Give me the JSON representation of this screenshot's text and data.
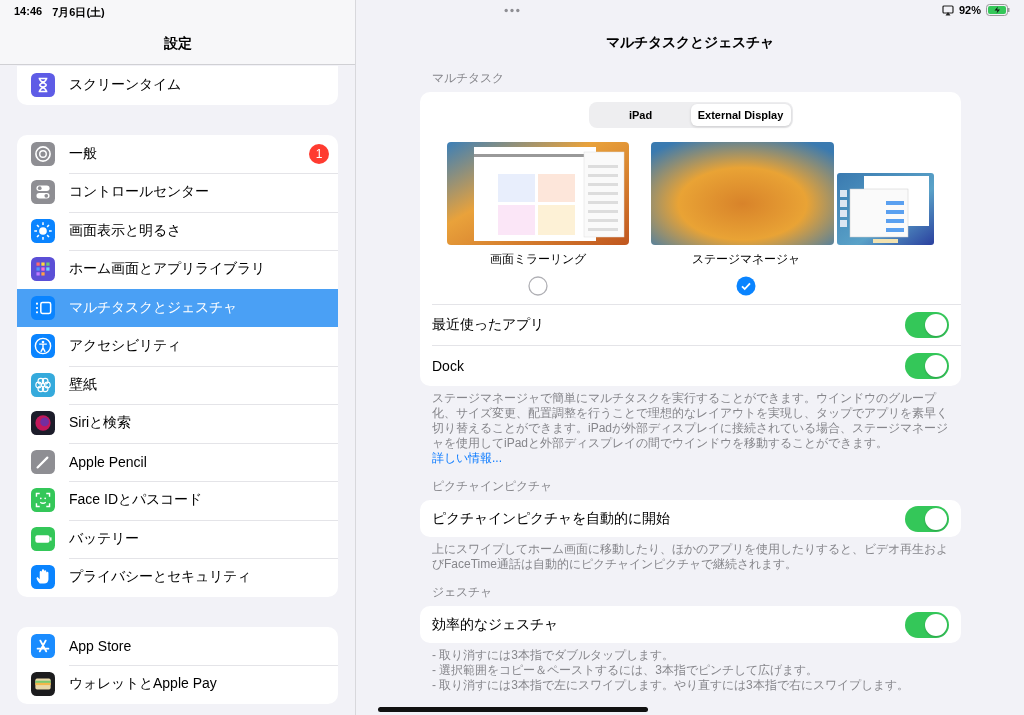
{
  "status_bar": {
    "time": "14:46",
    "date": "7月6日(土)",
    "battery": "92%"
  },
  "sidebar": {
    "title": "設定",
    "groups": [
      {
        "items": [
          {
            "label": "スクリーンタイム",
            "kind": "hourglass",
            "selected": false
          }
        ]
      },
      {
        "items": [
          {
            "label": "一般",
            "kind": "gear",
            "selected": false,
            "badge": "1"
          },
          {
            "label": "コントロールセンター",
            "kind": "switches",
            "selected": false
          },
          {
            "label": "画面表示と明るさ",
            "kind": "sun",
            "selected": false
          },
          {
            "label": "ホーム画面とアプリライブラリ",
            "kind": "grid",
            "selected": false
          },
          {
            "label": "マルチタスクとジェスチャ",
            "kind": "multitask",
            "selected": true
          },
          {
            "label": "アクセシビリティ",
            "kind": "accessibility",
            "selected": false
          },
          {
            "label": "壁紙",
            "kind": "flower",
            "selected": false
          },
          {
            "label": "Siriと検索",
            "kind": "orb",
            "selected": false
          },
          {
            "label": "Apple Pencil",
            "kind": "pencil",
            "selected": false
          },
          {
            "label": "Face IDとパスコード",
            "kind": "face",
            "selected": false
          },
          {
            "label": "バッテリー",
            "kind": "battery",
            "selected": false
          },
          {
            "label": "プライバシーとセキュリティ",
            "kind": "hand",
            "selected": false
          }
        ]
      },
      {
        "items": [
          {
            "label": "App Store",
            "kind": "appstore",
            "selected": false
          },
          {
            "label": "ウォレットとApple Pay",
            "kind": "wallet",
            "selected": false
          }
        ]
      }
    ]
  },
  "detail": {
    "title": "マルチタスクとジェスチャ",
    "multitask": {
      "header": "マルチタスク",
      "tabs": [
        {
          "label": "iPad",
          "selected": false
        },
        {
          "label": "External Display",
          "selected": true
        }
      ],
      "options": [
        {
          "label": "画面ミラーリング",
          "kind": "mirroring",
          "selected": false
        },
        {
          "label": "ステージマネージャ",
          "kind": "stage",
          "selected": true
        }
      ],
      "toggles": [
        {
          "label": "最近使ったアプリ",
          "on": true
        },
        {
          "label": "Dock",
          "on": true
        }
      ],
      "footer": "ステージマネージャで簡単にマルチタスクを実行することができます。ウインドウのグループ化、サイズ変更、配置調整を行うことで理想的なレイアウトを実現し、タップでアプリを素早く切り替えることができます。iPadが外部ディスプレイに接続されている場合、ステージマネージャを使用してiPadと外部ディスプレイの間でウインドウを移動することができます。",
      "link": "詳しい情報..."
    },
    "pip": {
      "header": "ピクチャインピクチャ",
      "toggle": {
        "label": "ピクチャインピクチャを自動的に開始",
        "on": true
      },
      "footer": "上にスワイプしてホーム画面に移動したり、ほかのアプリを使用したりすると、ビデオ再生およびFaceTime通話は自動的にピクチャインピクチャで継続されます。"
    },
    "gestures": {
      "header": "ジェスチャ",
      "toggle": {
        "label": "効率的なジェスチャ",
        "on": true
      },
      "footer_lines": [
        "- 取り消すには3本指でダブルタップします。",
        "- 選択範囲をコピー＆ペーストするには、3本指でピンチして広げます。",
        "- 取り消すには3本指で左にスワイプします。やり直すには3本指で右にスワイプします。"
      ]
    }
  }
}
